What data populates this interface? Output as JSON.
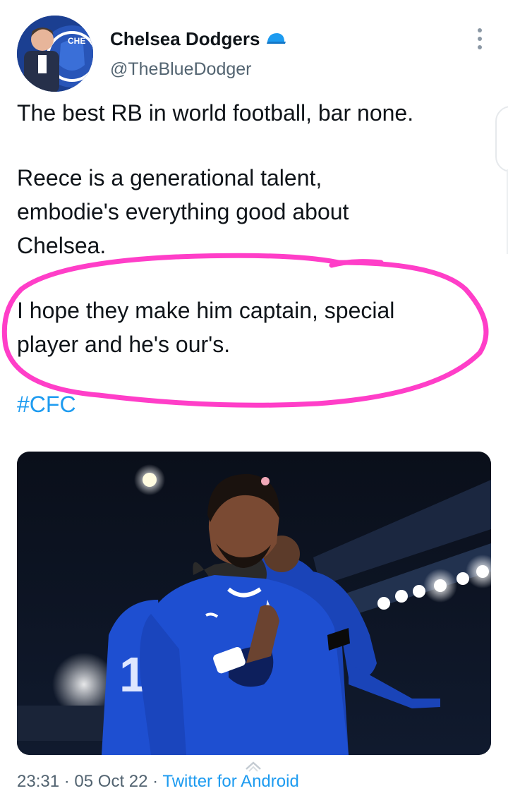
{
  "tweet": {
    "author": {
      "display_name": "Chelsea Dodgers",
      "handle": "@TheBlueDodger",
      "badge_icon": "blue-cap-icon",
      "avatar_badge_text": "CHE"
    },
    "text": {
      "p1": "The best RB in world football, bar none.",
      "p2_l1": "Reece is a generational talent,",
      "p2_l2": "embodie's everything good about",
      "p2_l3": "Chelsea.",
      "p3_l1": "I hope they make him captain, special",
      "p3_l2": "player and he's our's."
    },
    "hashtag": "#CFC",
    "meta": {
      "time": "23:31",
      "sep": "·",
      "date": "05 Oct 22",
      "source": "Twitter for Android"
    },
    "media": {
      "jersey_number": "1"
    }
  },
  "colors": {
    "link": "#1d9bf0",
    "annotation": "#ff3ec8",
    "kit_blue": "#1e4fd1"
  }
}
